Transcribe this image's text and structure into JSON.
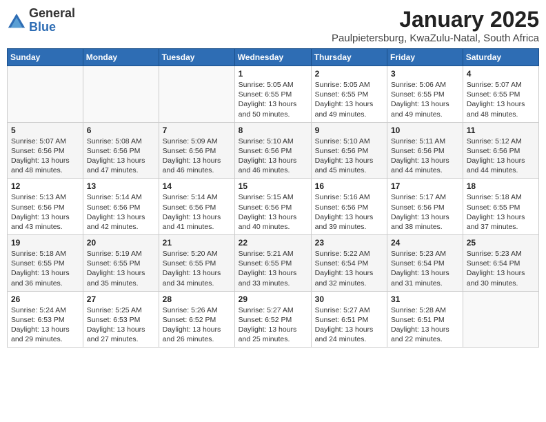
{
  "logo": {
    "general": "General",
    "blue": "Blue"
  },
  "header": {
    "month": "January 2025",
    "location": "Paulpietersburg, KwaZulu-Natal, South Africa"
  },
  "weekdays": [
    "Sunday",
    "Monday",
    "Tuesday",
    "Wednesday",
    "Thursday",
    "Friday",
    "Saturday"
  ],
  "weeks": [
    [
      {
        "day": "",
        "info": ""
      },
      {
        "day": "",
        "info": ""
      },
      {
        "day": "",
        "info": ""
      },
      {
        "day": "1",
        "info": "Sunrise: 5:05 AM\nSunset: 6:55 PM\nDaylight: 13 hours\nand 50 minutes."
      },
      {
        "day": "2",
        "info": "Sunrise: 5:05 AM\nSunset: 6:55 PM\nDaylight: 13 hours\nand 49 minutes."
      },
      {
        "day": "3",
        "info": "Sunrise: 5:06 AM\nSunset: 6:55 PM\nDaylight: 13 hours\nand 49 minutes."
      },
      {
        "day": "4",
        "info": "Sunrise: 5:07 AM\nSunset: 6:55 PM\nDaylight: 13 hours\nand 48 minutes."
      }
    ],
    [
      {
        "day": "5",
        "info": "Sunrise: 5:07 AM\nSunset: 6:56 PM\nDaylight: 13 hours\nand 48 minutes."
      },
      {
        "day": "6",
        "info": "Sunrise: 5:08 AM\nSunset: 6:56 PM\nDaylight: 13 hours\nand 47 minutes."
      },
      {
        "day": "7",
        "info": "Sunrise: 5:09 AM\nSunset: 6:56 PM\nDaylight: 13 hours\nand 46 minutes."
      },
      {
        "day": "8",
        "info": "Sunrise: 5:10 AM\nSunset: 6:56 PM\nDaylight: 13 hours\nand 46 minutes."
      },
      {
        "day": "9",
        "info": "Sunrise: 5:10 AM\nSunset: 6:56 PM\nDaylight: 13 hours\nand 45 minutes."
      },
      {
        "day": "10",
        "info": "Sunrise: 5:11 AM\nSunset: 6:56 PM\nDaylight: 13 hours\nand 44 minutes."
      },
      {
        "day": "11",
        "info": "Sunrise: 5:12 AM\nSunset: 6:56 PM\nDaylight: 13 hours\nand 44 minutes."
      }
    ],
    [
      {
        "day": "12",
        "info": "Sunrise: 5:13 AM\nSunset: 6:56 PM\nDaylight: 13 hours\nand 43 minutes."
      },
      {
        "day": "13",
        "info": "Sunrise: 5:14 AM\nSunset: 6:56 PM\nDaylight: 13 hours\nand 42 minutes."
      },
      {
        "day": "14",
        "info": "Sunrise: 5:14 AM\nSunset: 6:56 PM\nDaylight: 13 hours\nand 41 minutes."
      },
      {
        "day": "15",
        "info": "Sunrise: 5:15 AM\nSunset: 6:56 PM\nDaylight: 13 hours\nand 40 minutes."
      },
      {
        "day": "16",
        "info": "Sunrise: 5:16 AM\nSunset: 6:56 PM\nDaylight: 13 hours\nand 39 minutes."
      },
      {
        "day": "17",
        "info": "Sunrise: 5:17 AM\nSunset: 6:56 PM\nDaylight: 13 hours\nand 38 minutes."
      },
      {
        "day": "18",
        "info": "Sunrise: 5:18 AM\nSunset: 6:55 PM\nDaylight: 13 hours\nand 37 minutes."
      }
    ],
    [
      {
        "day": "19",
        "info": "Sunrise: 5:18 AM\nSunset: 6:55 PM\nDaylight: 13 hours\nand 36 minutes."
      },
      {
        "day": "20",
        "info": "Sunrise: 5:19 AM\nSunset: 6:55 PM\nDaylight: 13 hours\nand 35 minutes."
      },
      {
        "day": "21",
        "info": "Sunrise: 5:20 AM\nSunset: 6:55 PM\nDaylight: 13 hours\nand 34 minutes."
      },
      {
        "day": "22",
        "info": "Sunrise: 5:21 AM\nSunset: 6:55 PM\nDaylight: 13 hours\nand 33 minutes."
      },
      {
        "day": "23",
        "info": "Sunrise: 5:22 AM\nSunset: 6:54 PM\nDaylight: 13 hours\nand 32 minutes."
      },
      {
        "day": "24",
        "info": "Sunrise: 5:23 AM\nSunset: 6:54 PM\nDaylight: 13 hours\nand 31 minutes."
      },
      {
        "day": "25",
        "info": "Sunrise: 5:23 AM\nSunset: 6:54 PM\nDaylight: 13 hours\nand 30 minutes."
      }
    ],
    [
      {
        "day": "26",
        "info": "Sunrise: 5:24 AM\nSunset: 6:53 PM\nDaylight: 13 hours\nand 29 minutes."
      },
      {
        "day": "27",
        "info": "Sunrise: 5:25 AM\nSunset: 6:53 PM\nDaylight: 13 hours\nand 27 minutes."
      },
      {
        "day": "28",
        "info": "Sunrise: 5:26 AM\nSunset: 6:52 PM\nDaylight: 13 hours\nand 26 minutes."
      },
      {
        "day": "29",
        "info": "Sunrise: 5:27 AM\nSunset: 6:52 PM\nDaylight: 13 hours\nand 25 minutes."
      },
      {
        "day": "30",
        "info": "Sunrise: 5:27 AM\nSunset: 6:51 PM\nDaylight: 13 hours\nand 24 minutes."
      },
      {
        "day": "31",
        "info": "Sunrise: 5:28 AM\nSunset: 6:51 PM\nDaylight: 13 hours\nand 22 minutes."
      },
      {
        "day": "",
        "info": ""
      }
    ]
  ]
}
